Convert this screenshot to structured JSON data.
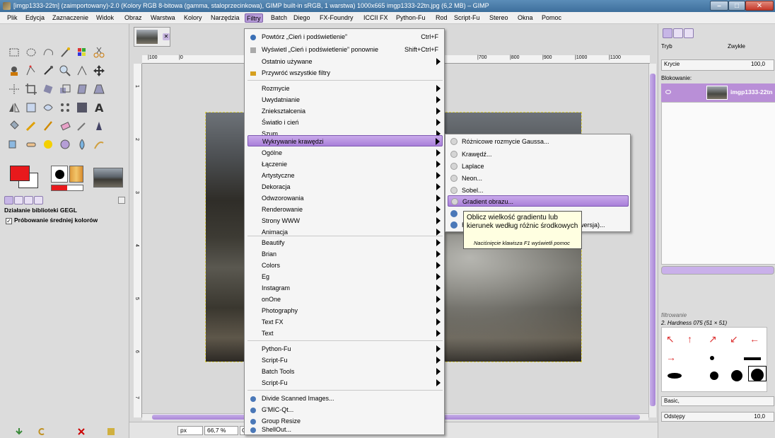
{
  "window": {
    "title": "[imgp1333-22tn] (zaimportowany)-2.0 (Kolory RGB 8-bitowa (gamma, staloprzecinkowa), GIMP built-in sRGB, 1 warstwa) 1000x665 imgp1333-22tn.jpg (6,2 MB) – GIMP",
    "min": "–",
    "max": "□",
    "close": "✕"
  },
  "menubar": [
    "Plik",
    "Edycja",
    "Zaznaczenie",
    "Widok",
    "Obraz",
    "Warstwa",
    "Kolory",
    "Narzędzia",
    "Filtry",
    "Batch",
    "Diego",
    "FX-Foundry",
    "ICCII FX",
    "Python-Fu",
    "Rod",
    "Script-Fu",
    "Stereo",
    "Okna",
    "Pomoc"
  ],
  "filters_menu": {
    "items": [
      {
        "label": "Powtórz „Cień i podświetlenie”",
        "shortcut": "Ctrl+F",
        "icon": "repeat-icon"
      },
      {
        "label": "Wyświetl „Cień i podświetlenie” ponownie",
        "shortcut": "Shift+Ctrl+F",
        "icon": "reshow-icon"
      },
      {
        "label": "Ostatnio używane",
        "submenu": true
      },
      {
        "label": "Przywróć wszystkie filtry",
        "icon": "reset-icon"
      },
      {
        "label": "Rozmycie",
        "submenu": true
      },
      {
        "label": "Uwydatnianie",
        "submenu": true
      },
      {
        "label": "Zniekształcenia",
        "submenu": true
      },
      {
        "label": "Światło i cień",
        "submenu": true
      },
      {
        "label": "Szum",
        "submenu": true
      },
      {
        "label": "Wykrywanie krawędzi",
        "submenu": true,
        "highlighted": true
      },
      {
        "label": "Ogólne",
        "submenu": true
      },
      {
        "label": "Łączenie",
        "submenu": true
      },
      {
        "label": "Artystyczne",
        "submenu": true
      },
      {
        "label": "Dekoracja",
        "submenu": true
      },
      {
        "label": "Odwzorowania",
        "submenu": true
      },
      {
        "label": "Renderowanie",
        "submenu": true
      },
      {
        "label": "Strony WWW",
        "submenu": true
      },
      {
        "label": "Animacja",
        "submenu": true
      },
      {
        "label": "Beautify",
        "submenu": true
      },
      {
        "label": "Brian",
        "submenu": true
      },
      {
        "label": "Colors",
        "submenu": true
      },
      {
        "label": "Eg",
        "submenu": true
      },
      {
        "label": "Instagram",
        "submenu": true
      },
      {
        "label": "onOne",
        "submenu": true
      },
      {
        "label": "Photography",
        "submenu": true
      },
      {
        "label": "Text FX",
        "submenu": true
      },
      {
        "label": "Text",
        "submenu": true
      },
      {
        "label": "Python-Fu",
        "submenu": true
      },
      {
        "label": "Script-Fu",
        "submenu": true
      },
      {
        "label": "Batch Tools",
        "submenu": true
      },
      {
        "label": "Script-Fu",
        "submenu": true
      },
      {
        "label": "Divide Scanned Images...",
        "icon": "python-icon"
      },
      {
        "label": "G'MIC-Qt...",
        "icon": "python-icon"
      },
      {
        "label": "Group Resize",
        "icon": "python-icon"
      },
      {
        "label": "ShellOut...",
        "icon": "python-icon"
      }
    ]
  },
  "edge_submenu": {
    "items": [
      {
        "label": "Różnicowe rozmycie Gaussa..."
      },
      {
        "label": "Krawędź..."
      },
      {
        "label": "Laplace"
      },
      {
        "label": "Neon..."
      },
      {
        "label": "Sobel..."
      },
      {
        "label": "Gradient obrazu...",
        "highlighted": true
      },
      {
        "label": ""
      },
      {
        "label": "R",
        "suffix": "wersja)..."
      }
    ]
  },
  "tooltip": {
    "text": "Oblicz wielkość gradientu lub kierunek według różnic środkowych",
    "hint": "Naciśnięcie klawisza F1 wyświetli pomoc"
  },
  "toolbox": {
    "gegl_title": "Działanie biblioteki GEGL",
    "sample_label": "Próbowanie średniej kolorów",
    "sample_checked": "✓"
  },
  "canvas": {
    "unit": "px",
    "zoom": "66,7 %",
    "status": "Ob",
    "ruler_top_labels": [
      "|100",
      "|0",
      "|700",
      "|800",
      "|900",
      "|1000",
      "|1100"
    ],
    "ruler_left_labels": [
      "1",
      "2",
      "3",
      "4",
      "5",
      "6",
      "7"
    ]
  },
  "right_dock": {
    "mode_label": "Tryb",
    "mode_value": "Zwykłe",
    "opacity_label": "Krycie",
    "opacity_value": "100,0",
    "lock_label": "Blokowanie:",
    "layer_name": "imgp1333-22tn",
    "filter_placeholder": "filtrowanie",
    "brush_name": "2. Hardness 075 (51 × 51)",
    "preset_value": "Basic,",
    "spacing_label": "Odstępy",
    "spacing_value": "10,0"
  },
  "colors": {
    "accent": "#b69bd8",
    "highlight": "#a97fd9",
    "fg": "#e8191c",
    "bg": "#ffffff"
  }
}
